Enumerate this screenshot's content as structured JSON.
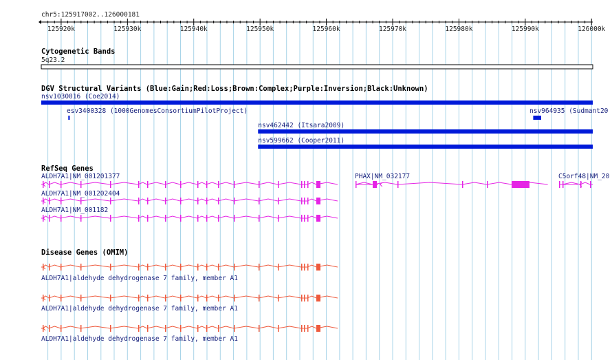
{
  "region": {
    "label": "chr5:125917002..126000181",
    "start": 125917002,
    "end": 126000181
  },
  "ruler": {
    "ticks": [
      125920000,
      125930000,
      125940000,
      125950000,
      125960000,
      125970000,
      125980000,
      125990000,
      126000000
    ],
    "tick_labels": [
      "125920k",
      "125930k",
      "125940k",
      "125950k",
      "125960k",
      "125970k",
      "125980k",
      "125990k",
      "126000k"
    ]
  },
  "colors": {
    "grid": "#a8d4e8",
    "variant": "#0019d9",
    "refseq": "#e524e5",
    "omim": "#ee5a3d",
    "text_dark": "#1a237e"
  },
  "tracks": {
    "cytoband": {
      "title": "Cytogenetic Bands",
      "band_label": "5q23.2"
    },
    "dgv": {
      "title": "DGV Structural Variants (Blue:Gain;Red:Loss;Brown:Complex;Purple:Inversion;Black:Unknown)",
      "features": [
        {
          "label": "nsv1030016 (Coe2014)",
          "start": 125917002,
          "end": 126000181
        },
        {
          "label": "esv3400328 (1000GenomesConsortiumPilotProject)",
          "start": 125921080,
          "end": 125921300
        },
        {
          "label": "nsv964935 (Sudmant20",
          "start": 125991200,
          "end": 125992400
        },
        {
          "label": "nsv462442 (Itsara2009)",
          "start": 125949700,
          "end": 126000181
        },
        {
          "label": "nsv599662 (Cooper2011)",
          "start": 125949700,
          "end": 126000181
        }
      ]
    },
    "refseq": {
      "title": "RefSeq Genes",
      "genes": [
        {
          "label": "ALDH7A1|NM_001201377",
          "start": 125917002,
          "end": 125961700
        },
        {
          "label": "ALDH7A1|NM_001202404",
          "start": 125917002,
          "end": 125961700
        },
        {
          "label": "ALDH7A1|NM_001182",
          "start": 125917002,
          "end": 125961700
        },
        {
          "label": "PHAX|NM_032177",
          "start": 125967800,
          "end": 125993400
        },
        {
          "label": "C5orf48|NM_20",
          "start": 125997900,
          "end": 126000181
        }
      ]
    },
    "omim": {
      "title": "Disease Genes (OMIM)",
      "genes": [
        {
          "label": "ALDH7A1|aldehyde dehydrogenase 7 family, member A1",
          "start": 125917002,
          "end": 125961700
        },
        {
          "label": "ALDH7A1|aldehyde dehydrogenase 7 family, member A1",
          "start": 125917002,
          "end": 125961700
        },
        {
          "label": "ALDH7A1|aldehyde dehydrogenase 7 family, member A1",
          "start": 125917002,
          "end": 125961700
        }
      ]
    }
  }
}
